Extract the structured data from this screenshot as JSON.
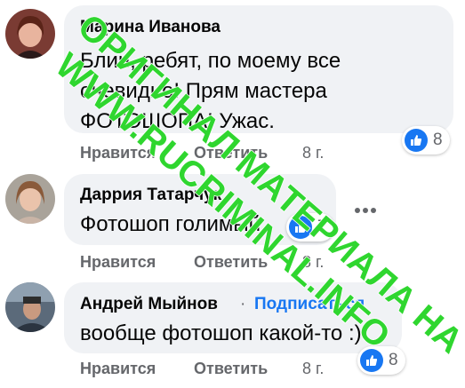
{
  "comments": [
    {
      "author": "Марина Иванова",
      "lines": [
        "Блин, ребят, по моему все",
        "очевидно! Прям мастера",
        "ФОТОШОПА! Ужас."
      ],
      "like_label": "Нравится",
      "reply_label": "Ответить",
      "time": "8 г.",
      "reaction_count": "8",
      "reaction_icon": "like-icon"
    },
    {
      "author": "Даррия Татарчук",
      "lines": [
        "Фотошоп голимый"
      ],
      "like_label": "Нравится",
      "reply_label": "Ответить",
      "time": "8 г.",
      "reaction_count": "7",
      "reaction_icon": "like-icon",
      "more_icon": "more-options-icon"
    },
    {
      "author": "Андрей Мыйнов",
      "follow_separator": "·",
      "follow_label": "Подписаться",
      "lines": [
        "вообще фотошоп какой-то :)"
      ],
      "like_label": "Нравится",
      "reply_label": "Ответить",
      "time": "8 г.",
      "reaction_count": "8",
      "reaction_icon": "like-icon"
    }
  ],
  "watermark": {
    "line1": "ОРИГИНАЛ МАТЕРИАЛА НА",
    "line2": "WWW.RUCRIMINAL.INFO",
    "color": "#2fd62f"
  },
  "colors": {
    "bubble": "#f0f2f5",
    "accent": "#1877f2",
    "meta": "#65676b",
    "text": "#050505"
  }
}
